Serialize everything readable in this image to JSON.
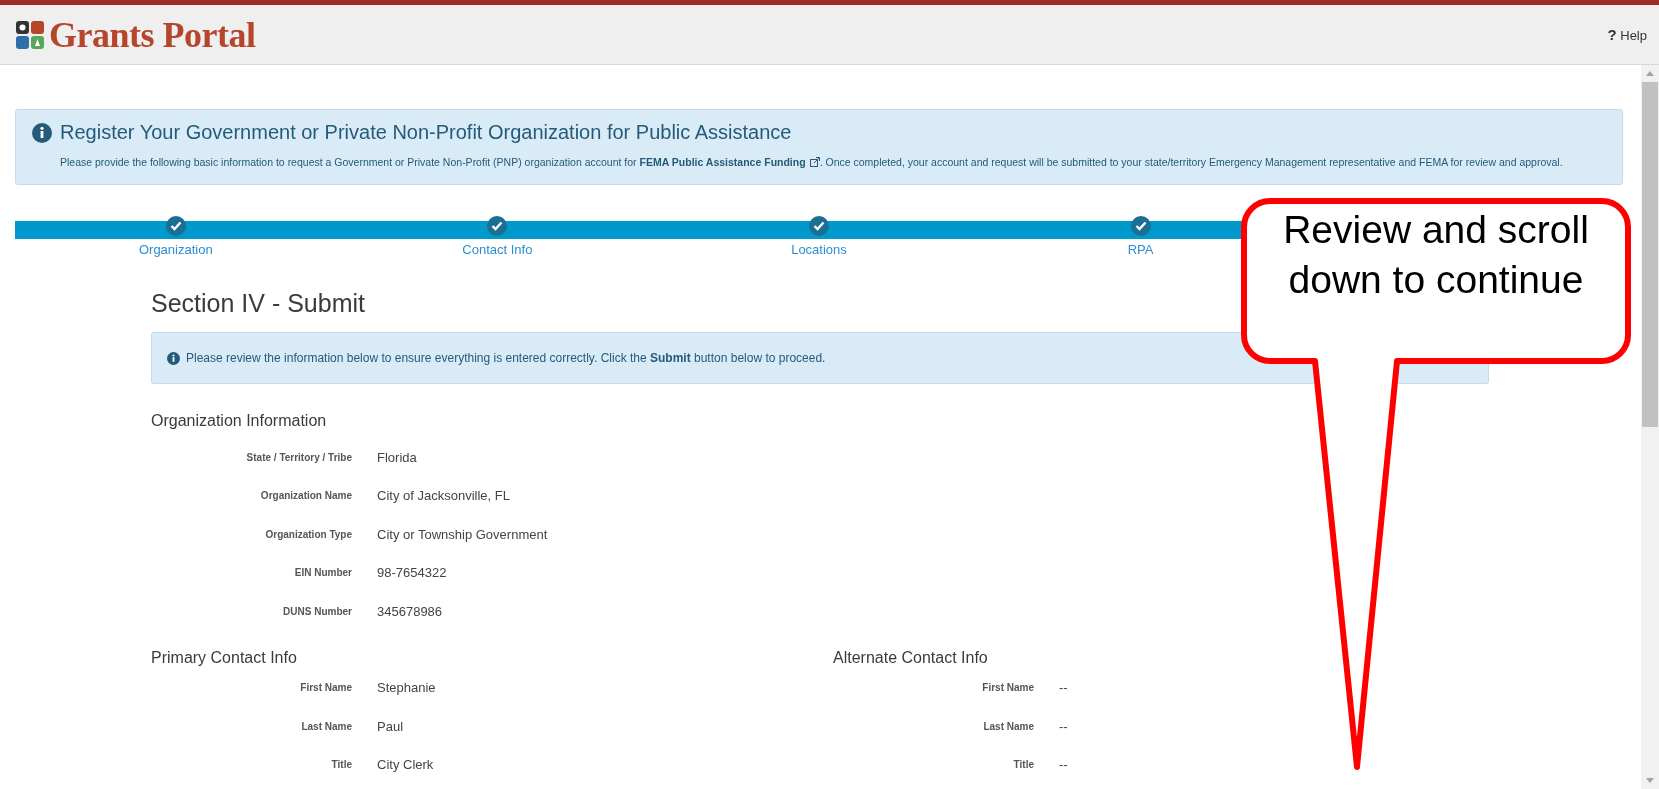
{
  "header": {
    "logo_text": "Grants Portal",
    "help": {
      "icon": "?",
      "label": "Help"
    }
  },
  "intro": {
    "title": "Register Your Government or Private Non-Profit Organization for Public Assistance",
    "text_before": "Please provide the following basic information to request a Government or Private Non-Profit (PNP) organization account for ",
    "link": "FEMA Public Assistance Funding",
    "text_after": ". Once completed, your account and request will be submitted to your state/territory Emergency Management representative and FEMA for review and approval."
  },
  "steps": [
    {
      "label": "Organization",
      "done": true
    },
    {
      "label": "Contact Info",
      "done": true
    },
    {
      "label": "Locations",
      "done": true
    },
    {
      "label": "RPA",
      "done": true
    }
  ],
  "section_title": "Section IV - Submit",
  "notice": "Please review the information below to ensure everything is entered correctly. Click the **Submit** button below to proceed.",
  "organization": {
    "title": "Organization Information",
    "fields": [
      {
        "label": "State / Territory / Tribe",
        "value": "Florida"
      },
      {
        "label": "Organization Name",
        "value": "City of Jacksonville, FL"
      },
      {
        "label": "Organization Type",
        "value": "City or Township Government"
      },
      {
        "label": "EIN Number",
        "value": "98-7654322"
      },
      {
        "label": "DUNS Number",
        "value": "345678986"
      }
    ]
  },
  "contacts": [
    {
      "title": "Primary Contact Info",
      "fields": [
        {
          "label": "First Name",
          "value": "Stephanie"
        },
        {
          "label": "Last Name",
          "value": "Paul"
        },
        {
          "label": "Title",
          "value": "City Clerk"
        }
      ]
    },
    {
      "title": "Alternate Contact Info",
      "fields": [
        {
          "label": "First Name",
          "value": "--"
        },
        {
          "label": "Last Name",
          "value": "--"
        },
        {
          "label": "Title",
          "value": "--"
        }
      ]
    }
  ],
  "callout": {
    "text": "Review and scroll down to continue"
  }
}
